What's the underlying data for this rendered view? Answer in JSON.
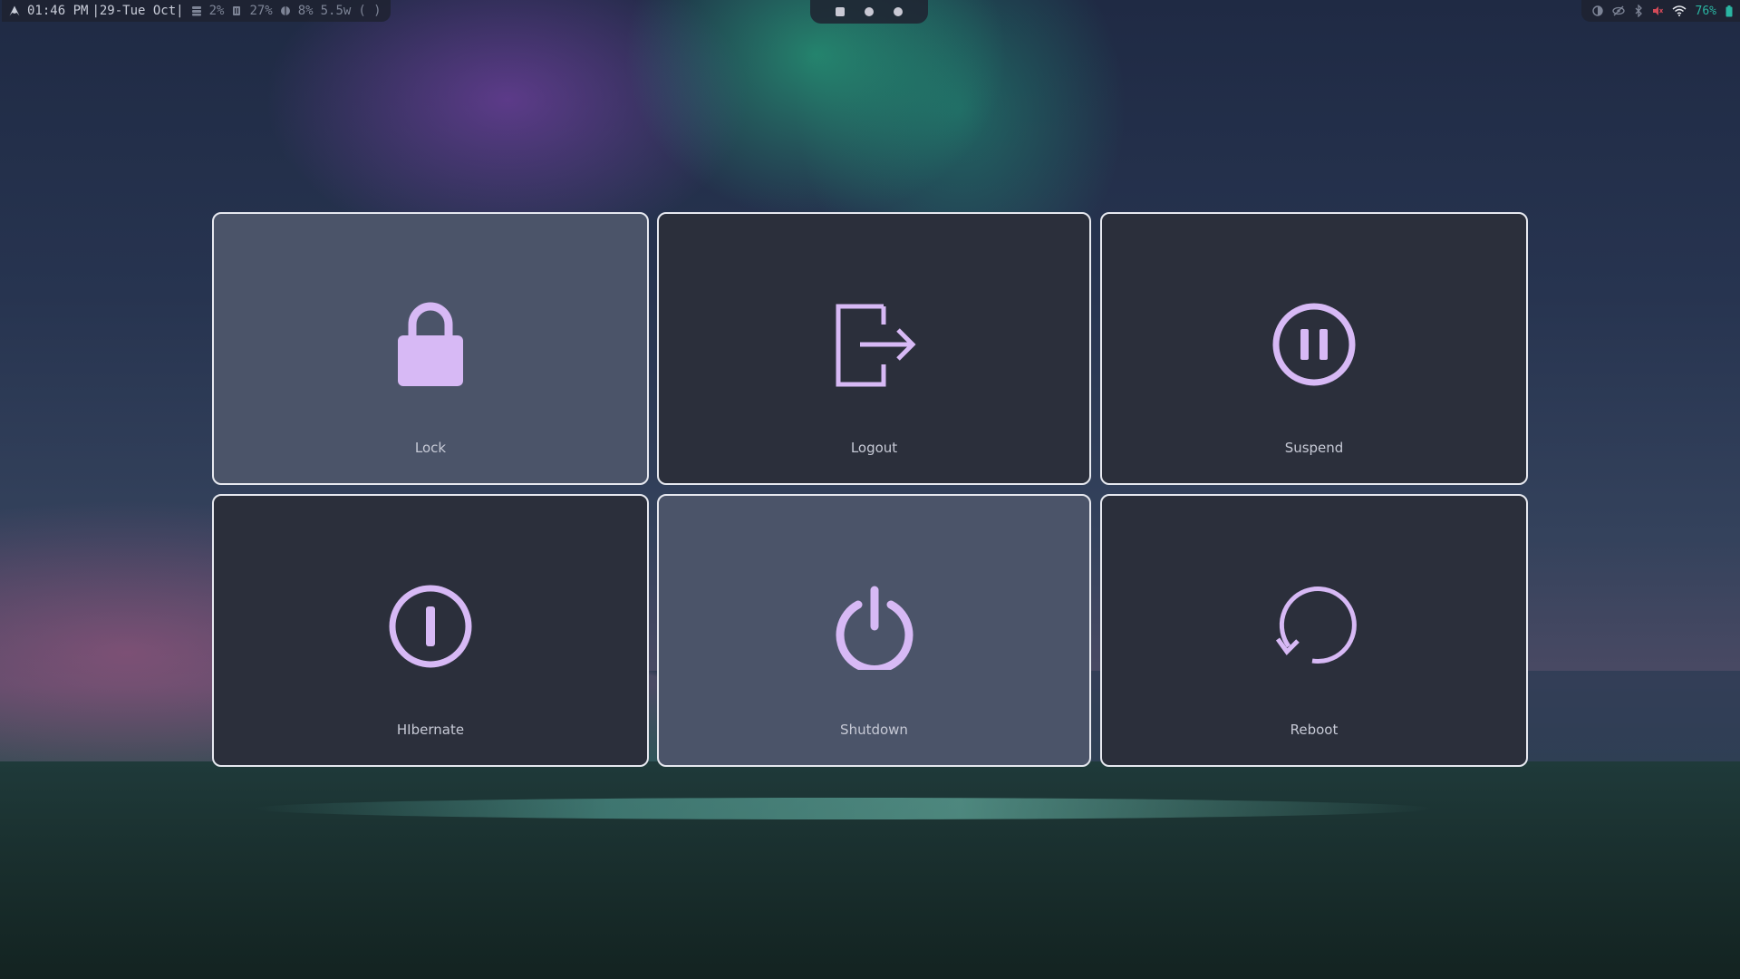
{
  "topbar": {
    "time": "01:46 PM",
    "date": "|29-Tue Oct|",
    "disk": "2%",
    "memory": "27%",
    "cpu": "8%",
    "power": "5.5w",
    "bracket": "(  )",
    "wifi_percent": "76%"
  },
  "colors": {
    "accent": "#d7b9f5",
    "tile_bg": "#2b2f3b",
    "tile_highlight": "#4b5469",
    "tile_border": "#e6e8ef",
    "label": "#c7cad6"
  },
  "menu": {
    "items": [
      {
        "label": "Lock",
        "icon": "lock-icon",
        "highlighted": true
      },
      {
        "label": "Logout",
        "icon": "logout-icon",
        "highlighted": false
      },
      {
        "label": "Suspend",
        "icon": "pause-icon",
        "highlighted": false
      },
      {
        "label": "HIbernate",
        "icon": "hibernate-icon",
        "highlighted": false
      },
      {
        "label": "Shutdown",
        "icon": "power-icon",
        "highlighted": true
      },
      {
        "label": "Reboot",
        "icon": "reboot-icon",
        "highlighted": false
      }
    ]
  }
}
